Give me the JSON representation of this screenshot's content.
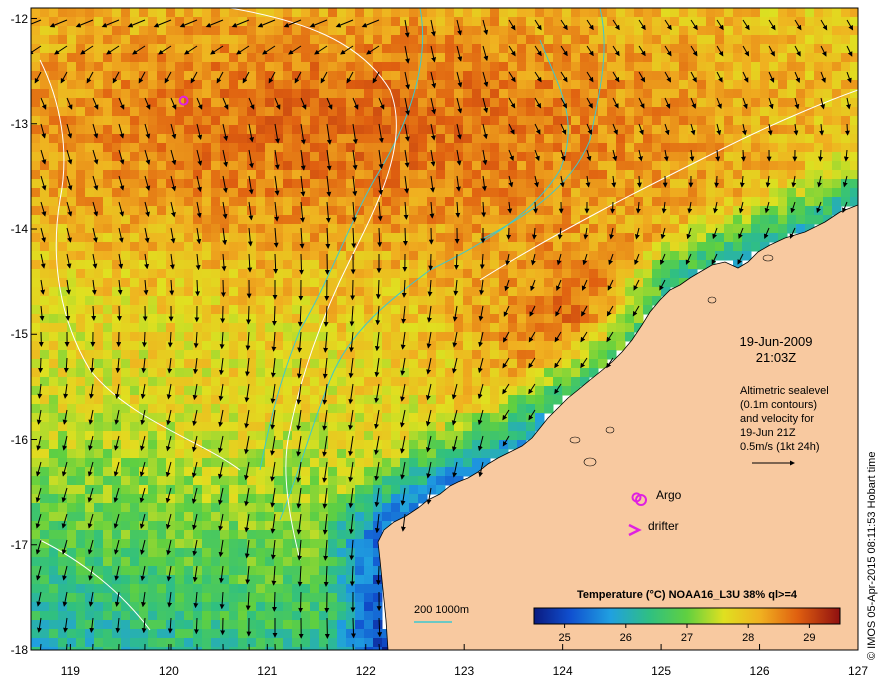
{
  "map": {
    "x_ticks": [
      "119",
      "120",
      "121",
      "122",
      "123",
      "124",
      "125",
      "126",
      "127"
    ],
    "y_ticks": [
      "-12",
      "-13",
      "-14",
      "-15",
      "-16",
      "-17",
      "-18"
    ],
    "lon_range": [
      118.6,
      127.0
    ],
    "lat_range": [
      -18.0,
      -11.9
    ]
  },
  "info": {
    "date": "19-Jun-2009",
    "time": "21:03Z",
    "note_lines": [
      "Altimetric sealevel",
      "(0.1m contours)",
      "and velocity for",
      "19-Jun 21Z",
      "0.5m/s (1kt 24h)"
    ]
  },
  "legend": {
    "colorbar_title": "Temperature (°C) NOAA16_L3U 38% ql>=4",
    "colorbar_ticks": [
      "25",
      "26",
      "27",
      "28",
      "29"
    ],
    "colorbar_range": [
      24.5,
      29.5
    ],
    "contour_label": "200  1000m",
    "argo_label": "Argo",
    "drifter_label": "drifter",
    "credit": "© IMOS 05-Apr-2015 08:11:53 Hobart time"
  },
  "colors": {
    "land": "#f8c9a0",
    "argo_marker": "#e020e0",
    "bathymetry_contour": "#3cc8d0",
    "sealevel_contour": "#ffffff",
    "sst_warm": "#e8a030",
    "sst_mid": "#e0e030",
    "sst_cool": "#30c040",
    "sst_cold": "#1030b0"
  },
  "markers": {
    "argo_floats": [
      {
        "lon": 120.15,
        "lat": -12.78
      },
      {
        "lon": 124.75,
        "lat": -16.55
      }
    ]
  }
}
